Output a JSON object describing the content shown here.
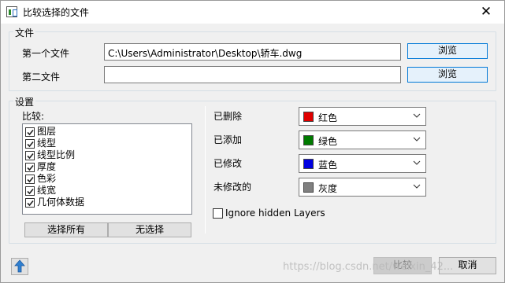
{
  "window": {
    "title": "比较选择的文件",
    "close_glyph": "✕"
  },
  "files": {
    "group_label": "文件",
    "first_label": "第一个文件",
    "first_value": "C:\\Users\\Administrator\\Desktop\\轿车.dwg",
    "second_label": "第二文件",
    "second_value": "",
    "browse_label": "浏览"
  },
  "settings": {
    "group_label": "设置",
    "compare_label": "比较:",
    "items": [
      {
        "label": "图层",
        "checked": true
      },
      {
        "label": "线型",
        "checked": true
      },
      {
        "label": "线型比例",
        "checked": true
      },
      {
        "label": "厚度",
        "checked": true
      },
      {
        "label": "色彩",
        "checked": true
      },
      {
        "label": "线宽",
        "checked": true
      },
      {
        "label": "几何体数据",
        "checked": true
      }
    ],
    "select_all_label": "选择所有",
    "select_none_label": "无选择",
    "colors": [
      {
        "label": "已删除",
        "value": "红色",
        "swatch": "#e00000"
      },
      {
        "label": "已添加",
        "value": "绿色",
        "swatch": "#007a00"
      },
      {
        "label": "已修改",
        "value": "蓝色",
        "swatch": "#0000e0"
      },
      {
        "label": "未修改的",
        "value": "灰度",
        "swatch": "#808080"
      }
    ],
    "ignore_hidden_label": "Ignore hidden Layers",
    "ignore_hidden_checked": false
  },
  "footer": {
    "compare_button": "比较",
    "cancel_button": "取消",
    "watermark": "https://blog.csdn.net/weixin_42..."
  }
}
